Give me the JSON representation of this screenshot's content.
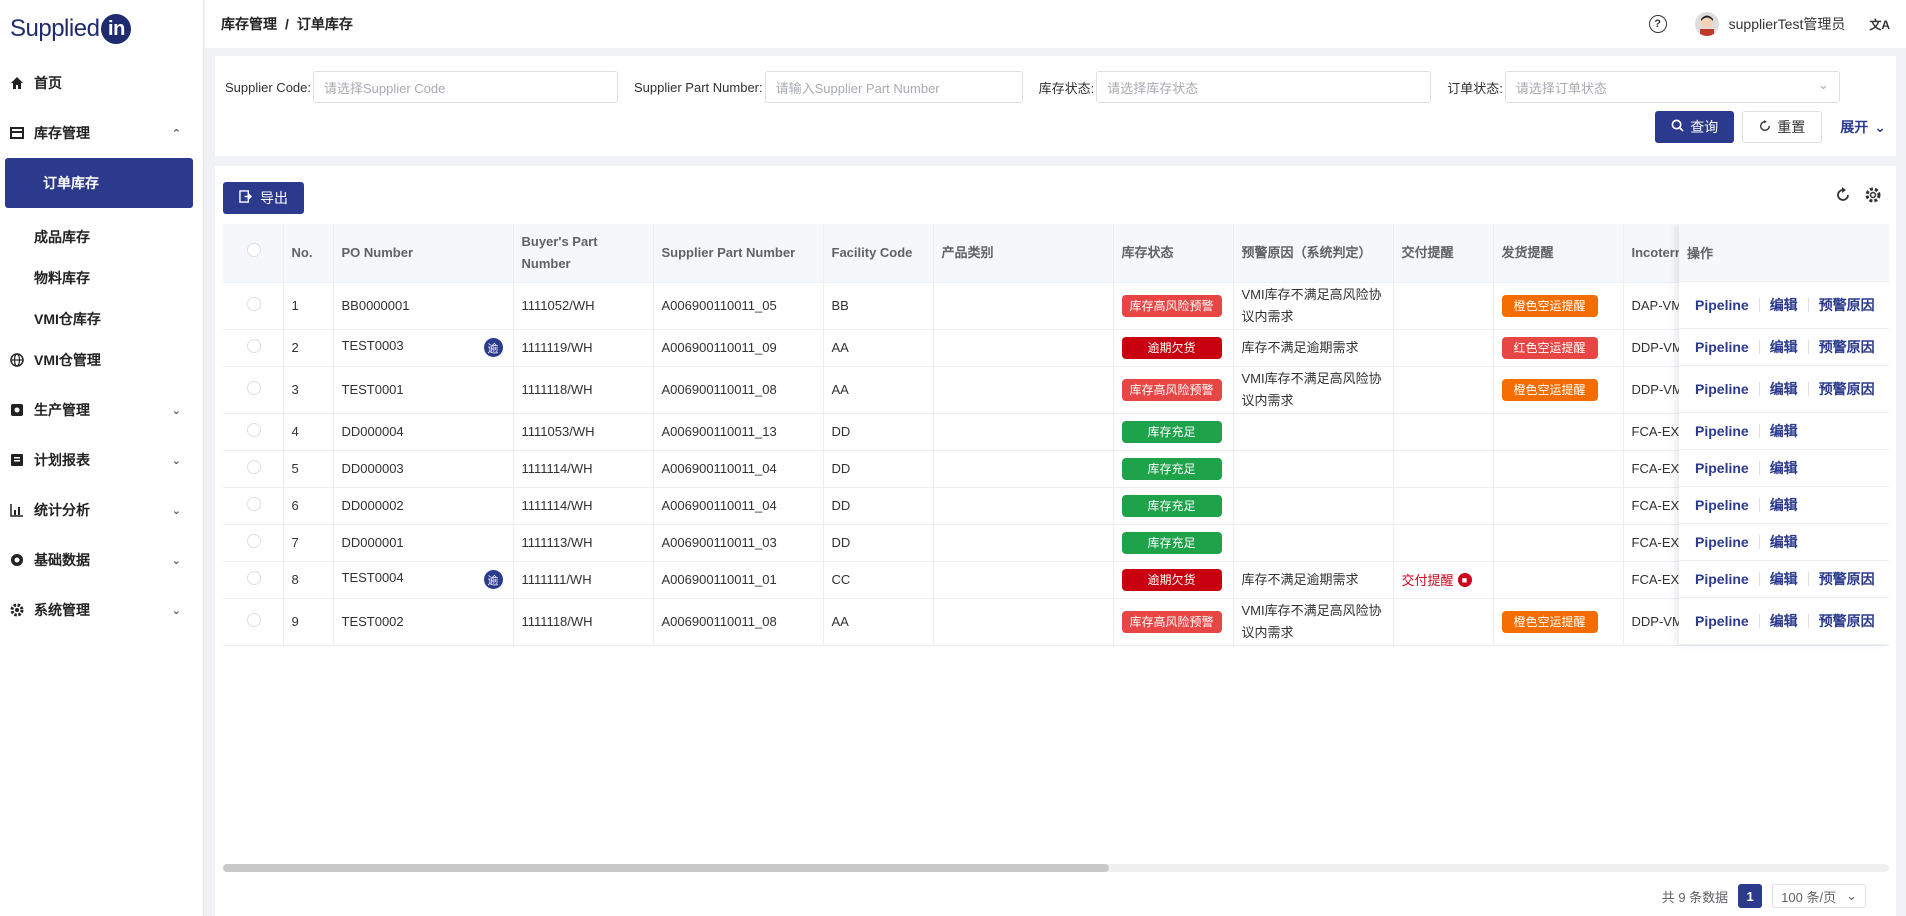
{
  "brand": {
    "name": "Supplied",
    "in": "in"
  },
  "sidebar": {
    "items": [
      {
        "label": "首页",
        "icon": "home-icon"
      },
      {
        "label": "库存管理",
        "icon": "inventory-icon"
      },
      {
        "label": "订单库存"
      },
      {
        "label": "成品库存"
      },
      {
        "label": "物料库存"
      },
      {
        "label": "VMI仓库存"
      },
      {
        "label": "VMI仓管理",
        "icon": "globe-icon"
      },
      {
        "label": "生产管理",
        "icon": "production-icon"
      },
      {
        "label": "计划报表",
        "icon": "report-icon"
      },
      {
        "label": "统计分析",
        "icon": "chart-icon"
      },
      {
        "label": "基础数据",
        "icon": "data-icon"
      },
      {
        "label": "系统管理",
        "icon": "settings-icon"
      }
    ]
  },
  "header": {
    "breadcrumb": [
      "库存管理",
      "订单库存"
    ],
    "separator": "/",
    "user": "supplierTest管理员",
    "help": "?",
    "lang": "文A"
  },
  "filters": {
    "supplier_code": {
      "label": "Supplier Code:",
      "placeholder": "请选择Supplier Code"
    },
    "supplier_part": {
      "label": "Supplier Part Number:",
      "placeholder": "请输入Supplier Part Number"
    },
    "stock_status": {
      "label": "库存状态:",
      "placeholder": "请选择库存状态"
    },
    "order_status": {
      "label": "订单状态:",
      "placeholder": "请选择订单状态"
    },
    "query_label": "查询",
    "reset_label": "重置",
    "expand_label": "展开"
  },
  "toolbar": {
    "export_label": "导出"
  },
  "table": {
    "headers": [
      "No.",
      "PO Number",
      "Buyer's Part Number",
      "Supplier Part Number",
      "Facility Code",
      "产品类别",
      "库存状态",
      "预警原因（系统判定）",
      "交付提醒",
      "发货提醒",
      "Incoterms",
      "操作"
    ],
    "overdue_badge": "逾",
    "rows": [
      {
        "no": "1",
        "po": "BB0000001",
        "overdue": false,
        "buyer": "1111052/WH",
        "supplier": "A006900110011_05",
        "facility": "BB",
        "category": "",
        "status": "库存高风险预警",
        "status_color": "#e84545",
        "reason": "VMI库存不满足高风险协议内需求",
        "delivery": "",
        "ship": "橙色空运提醒",
        "ship_color": "#f56c00",
        "incoterm": "DAP-VMI",
        "ops": [
          "Pipeline",
          "编辑",
          "预警原因"
        ]
      },
      {
        "no": "2",
        "po": "TEST0003",
        "overdue": true,
        "buyer": "1111119/WH",
        "supplier": "A006900110011_09",
        "facility": "AA",
        "category": "",
        "status": "逾期欠货",
        "status_color": "#c8000f",
        "reason": "库存不满足逾期需求",
        "delivery": "",
        "ship": "红色空运提醒",
        "ship_color": "#e84545",
        "incoterm": "DDP-VMI",
        "ops": [
          "Pipeline",
          "编辑",
          "预警原因"
        ]
      },
      {
        "no": "3",
        "po": "TEST0001",
        "overdue": false,
        "buyer": "1111118/WH",
        "supplier": "A006900110011_08",
        "facility": "AA",
        "category": "",
        "status": "库存高风险预警",
        "status_color": "#e84545",
        "reason": "VMI库存不满足高风险协议内需求",
        "delivery": "",
        "ship": "橙色空运提醒",
        "ship_color": "#f56c00",
        "incoterm": "DDP-VMI",
        "ops": [
          "Pipeline",
          "编辑",
          "预警原因"
        ]
      },
      {
        "no": "4",
        "po": "DD000004",
        "overdue": false,
        "buyer": "1111053/WH",
        "supplier": "A006900110011_13",
        "facility": "DD",
        "category": "",
        "status": "库存充足",
        "status_color": "#1fa34a",
        "reason": "",
        "delivery": "",
        "ship": "",
        "ship_color": "",
        "incoterm": "FCA-EXW",
        "ops": [
          "Pipeline",
          "编辑"
        ]
      },
      {
        "no": "5",
        "po": "DD000003",
        "overdue": false,
        "buyer": "1111114/WH",
        "supplier": "A006900110011_04",
        "facility": "DD",
        "category": "",
        "status": "库存充足",
        "status_color": "#1fa34a",
        "reason": "",
        "delivery": "",
        "ship": "",
        "ship_color": "",
        "incoterm": "FCA-EXW",
        "ops": [
          "Pipeline",
          "编辑"
        ]
      },
      {
        "no": "6",
        "po": "DD000002",
        "overdue": false,
        "buyer": "1111114/WH",
        "supplier": "A006900110011_04",
        "facility": "DD",
        "category": "",
        "status": "库存充足",
        "status_color": "#1fa34a",
        "reason": "",
        "delivery": "",
        "ship": "",
        "ship_color": "",
        "incoterm": "FCA-EXW",
        "ops": [
          "Pipeline",
          "编辑"
        ]
      },
      {
        "no": "7",
        "po": "DD000001",
        "overdue": false,
        "buyer": "1111113/WH",
        "supplier": "A006900110011_03",
        "facility": "DD",
        "category": "",
        "status": "库存充足",
        "status_color": "#1fa34a",
        "reason": "",
        "delivery": "",
        "ship": "",
        "ship_color": "",
        "incoterm": "FCA-EXW",
        "ops": [
          "Pipeline",
          "编辑"
        ]
      },
      {
        "no": "8",
        "po": "TEST0004",
        "overdue": true,
        "buyer": "1111111/WH",
        "supplier": "A006900110011_01",
        "facility": "CC",
        "category": "",
        "status": "逾期欠货",
        "status_color": "#c8000f",
        "reason": "库存不满足逾期需求",
        "delivery": "交付提醒",
        "ship": "",
        "ship_color": "",
        "incoterm": "FCA-EXW",
        "ops": [
          "Pipeline",
          "编辑",
          "预警原因"
        ]
      },
      {
        "no": "9",
        "po": "TEST0002",
        "overdue": false,
        "buyer": "1111118/WH",
        "supplier": "A006900110011_08",
        "facility": "AA",
        "category": "",
        "status": "库存高风险预警",
        "status_color": "#e84545",
        "reason": "VMI库存不满足高风险协议内需求",
        "delivery": "",
        "ship": "橙色空运提醒",
        "ship_color": "#f56c00",
        "incoterm": "DDP-VMI",
        "ops": [
          "Pipeline",
          "编辑",
          "预警原因"
        ]
      }
    ]
  },
  "pagination": {
    "total_text": "共 9 条数据",
    "current": "1",
    "page_size": "100 条/页"
  }
}
